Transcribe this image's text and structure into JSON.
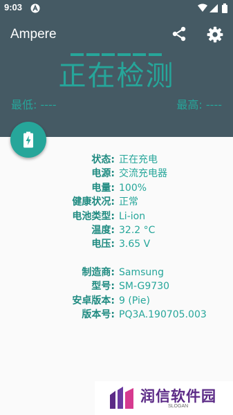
{
  "status_bar": {
    "time": "9:03"
  },
  "toolbar": {
    "title": "Ampere"
  },
  "meter": {
    "status": "正在检测",
    "min_label": "最低: ----",
    "max_label": "最高: ----"
  },
  "info": {
    "status": {
      "label": "状态:",
      "value": "正在充电"
    },
    "power_source": {
      "label": "电源:",
      "value": "交流充电器"
    },
    "level": {
      "label": "电量:",
      "value": "100%"
    },
    "health": {
      "label": "健康状况:",
      "value": "正常"
    },
    "battery_type": {
      "label": "电池类型:",
      "value": "Li-ion"
    },
    "temperature": {
      "label": "温度:",
      "value": "32.2 °C"
    },
    "voltage": {
      "label": "电压:",
      "value": "3.65 V"
    },
    "manufacturer": {
      "label": "制造商:",
      "value": "Samsung"
    },
    "model": {
      "label": "型号:",
      "value": "SM-G9730"
    },
    "android_version": {
      "label": "安卓版本:",
      "value": "9 (Pie)"
    },
    "build_number": {
      "label": "版本号:",
      "value": "PQ3A.190705.003"
    }
  },
  "watermark": {
    "text": "润信软件园",
    "slogan": "SLOGAN"
  },
  "colors": {
    "header": "#455a64",
    "accent": "#26a69a"
  },
  "icons": [
    "a-icon",
    "wifi-icon",
    "signal-icon",
    "battery-icon",
    "share-icon",
    "settings-icon",
    "battery-charging-icon"
  ]
}
